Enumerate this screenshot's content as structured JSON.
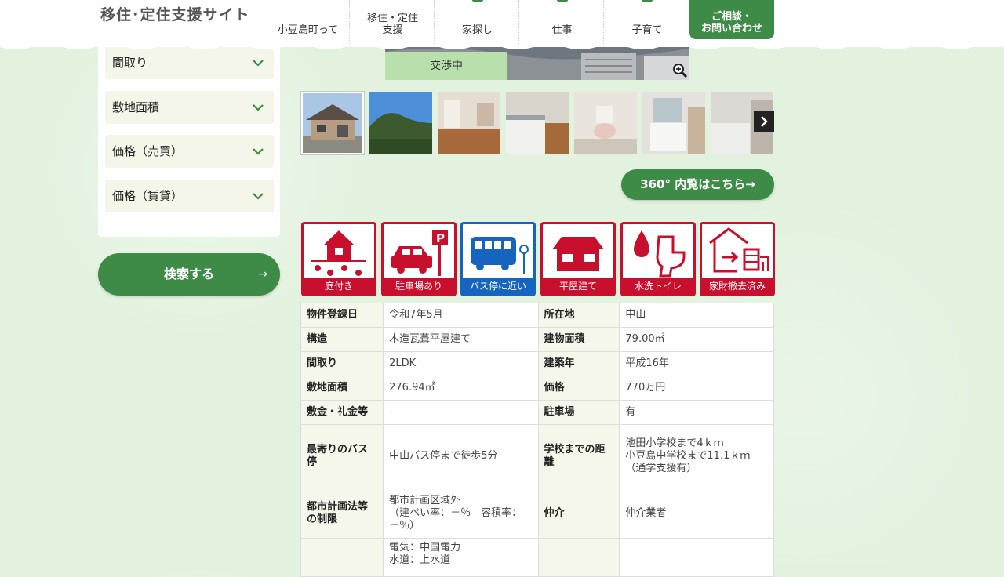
{
  "header": {
    "site_title": "移住･定住支援サイト",
    "nav": [
      {
        "label": "小豆島町って"
      },
      {
        "label": "移住・定住\n支援"
      },
      {
        "label": "家探し"
      },
      {
        "label": "仕事"
      },
      {
        "label": "子育て"
      }
    ],
    "contact": {
      "line1": "ご相談・",
      "line2": "お問い合わせ"
    }
  },
  "sidebar": {
    "filters": [
      {
        "label": "間取り"
      },
      {
        "label": "敷地面積"
      },
      {
        "label": "価格（売買）"
      },
      {
        "label": "価格（賃貸）"
      }
    ],
    "search_label": "検索する",
    "search_arrow": "→"
  },
  "property": {
    "status_badge": "交渉中",
    "tour_button": "360° 内覧はこちら→",
    "features": [
      {
        "label": "庭付き",
        "icon": "garden-house-icon",
        "color": "#c8102e"
      },
      {
        "label": "駐車場あり",
        "icon": "car-parking-icon",
        "color": "#c8102e"
      },
      {
        "label": "バス停に近い",
        "icon": "bus-stop-icon",
        "color": "#1565c0"
      },
      {
        "label": "平屋建て",
        "icon": "single-story-house-icon",
        "color": "#c8102e"
      },
      {
        "label": "水洗トイレ",
        "icon": "flush-toilet-icon",
        "color": "#c8102e"
      },
      {
        "label": "家財撤去済み",
        "icon": "furniture-removed-icon",
        "color": "#c8102e"
      }
    ],
    "details": [
      {
        "k1": "物件登録日",
        "v1": "令和7年5月",
        "k2": "所在地",
        "v2": "中山"
      },
      {
        "k1": "構造",
        "v1": "木造瓦葺平屋建て",
        "k2": "建物面積",
        "v2": "79.00㎡"
      },
      {
        "k1": "間取り",
        "v1": "2LDK",
        "k2": "建築年",
        "v2": "平成16年"
      },
      {
        "k1": "敷地面積",
        "v1": "276.94㎡",
        "k2": "価格",
        "v2": "770万円"
      },
      {
        "k1": "敷金・礼金等",
        "v1": "-",
        "k2": "駐車場",
        "v2": "有"
      },
      {
        "k1": "最寄りのバス停",
        "v1": "中山バス停まで徒歩5分",
        "k2": "学校までの距離",
        "v2": "池田小学校まで4ｋｍ\n小豆島中学校まで11.1ｋｍ\n（通学支援有）"
      },
      {
        "k1": "都市計画法等の制限",
        "v1": "都市計画区域外\n（建ぺい率：－％　容積率：－％）",
        "k2": "仲介",
        "v2": "仲介業者"
      },
      {
        "k1": "",
        "v1": "電気：中国電力\n水道：上水道",
        "k2": "",
        "v2": ""
      }
    ]
  },
  "colors": {
    "brand_green": "#3d8b47",
    "feature_red": "#c8102e",
    "feature_blue": "#1565c0"
  }
}
